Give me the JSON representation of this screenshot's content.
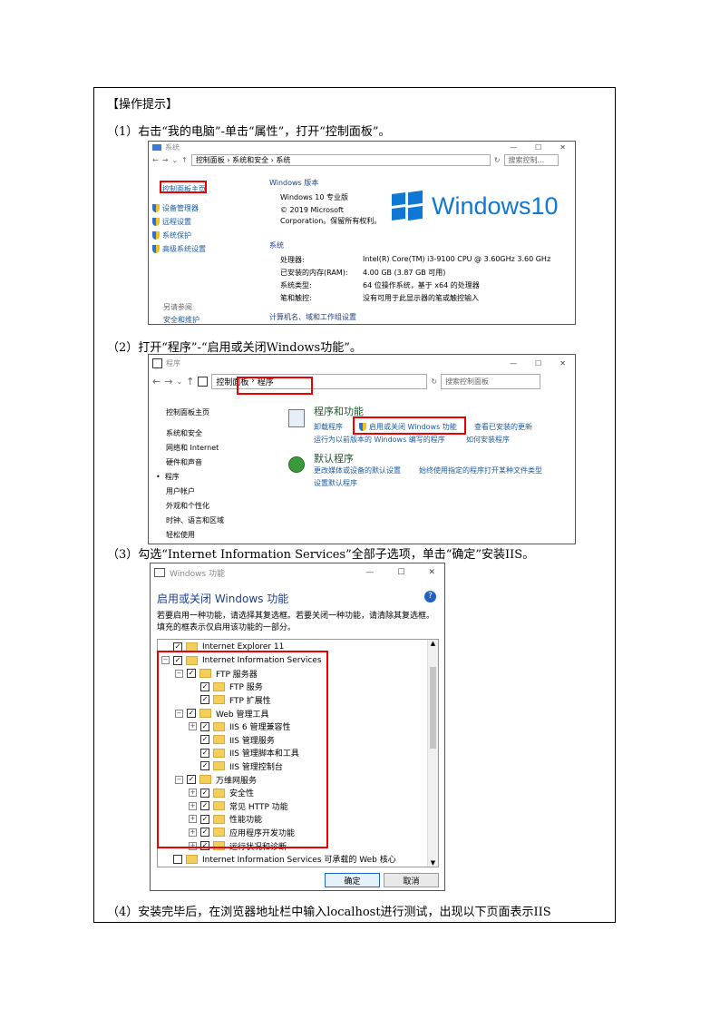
{
  "doc": {
    "heading": "【操作提示】",
    "step1": "（1）右击“我的电脑”-单击“属性”，打开“控制面板”。",
    "step2": "（2）打开“程序”-“启用或关闭Windows功能”。",
    "step3": "（3）勾选“Internet Information Services”全部子选项，单击“确定”安装IIS。",
    "step4": "（4）安装完毕后，在浏览器地址栏中输入localhost进行测试，出现以下页面表示IIS"
  },
  "shot1": {
    "title": "系统",
    "path": [
      "控制面板",
      "系统和安全",
      "系统"
    ],
    "search_placeholder": "搜索控制...",
    "home": "控制面板主页",
    "sidebar": [
      "设备管理器",
      "远程设置",
      "系统保护",
      "高级系统设置"
    ],
    "see_also": "另请参阅",
    "see_also_item": "安全和维护",
    "edition_header": "Windows 版本",
    "edition": "Windows 10 专业版",
    "copyright1": "© 2019 Microsoft",
    "copyright2": "Corporation。保留所有权利。",
    "logo_text": "Windows10",
    "system_header": "系统",
    "specs": [
      {
        "k": "处理器:",
        "v": "Intel(R) Core(TM) i3-9100 CPU @ 3.60GHz   3.60 GHz"
      },
      {
        "k": "已安装的内存(RAM):",
        "v": "4.00 GB (3.87 GB 可用)"
      },
      {
        "k": "系统类型:",
        "v": "64 位操作系统，基于 x64 的处理器"
      },
      {
        "k": "笔和触控:",
        "v": "没有可用于此显示器的笔或触控输入"
      }
    ],
    "footer": "计算机名、域和工作组设置"
  },
  "shot2": {
    "title": "程序",
    "path": [
      "控制面板",
      "程序"
    ],
    "search_placeholder": "搜索控制面板",
    "nav": [
      "控制面板主页",
      "系统和安全",
      "网络和 Internet",
      "硬件和声音",
      "程序",
      "用户帐户",
      "外观和个性化",
      "时钟、语言和区域",
      "轻松使用"
    ],
    "section1_title": "程序和功能",
    "section1_links": [
      "卸载程序",
      "启用或关闭 Windows 功能",
      "查看已安装的更新",
      "运行为以前版本的 Windows 编写的程序",
      "如何安装程序"
    ],
    "section2_title": "默认程序",
    "section2_links": [
      "更改媒体或设备的默认设置",
      "始终使用指定的程序打开某种文件类型",
      "设置默认程序"
    ]
  },
  "shot3": {
    "title": "Windows 功能",
    "heading": "启用或关闭 Windows 功能",
    "desc": "若要启用一种功能，请选择其复选框。若要关闭一种功能，请清除其复选框。填充的框表示仅启用该功能的一部分。",
    "tree": [
      {
        "label": "Internet Explorer 11",
        "level": 0,
        "expander": "",
        "checked": true
      },
      {
        "label": "Internet Information Services",
        "level": 0,
        "expander": "−",
        "checked": true
      },
      {
        "label": "FTP 服务器",
        "level": 1,
        "expander": "−",
        "checked": true
      },
      {
        "label": "FTP 服务",
        "level": 2,
        "expander": "",
        "checked": true
      },
      {
        "label": "FTP 扩展性",
        "level": 2,
        "expander": "",
        "checked": true
      },
      {
        "label": "Web 管理工具",
        "level": 1,
        "expander": "−",
        "checked": true
      },
      {
        "label": "IIS 6 管理兼容性",
        "level": 2,
        "expander": "+",
        "checked": true
      },
      {
        "label": "IIS 管理服务",
        "level": 2,
        "expander": "",
        "checked": true
      },
      {
        "label": "IIS 管理脚本和工具",
        "level": 2,
        "expander": "",
        "checked": true
      },
      {
        "label": "IIS 管理控制台",
        "level": 2,
        "expander": "",
        "checked": true
      },
      {
        "label": "万维网服务",
        "level": 1,
        "expander": "−",
        "checked": true
      },
      {
        "label": "安全性",
        "level": 2,
        "expander": "+",
        "checked": true
      },
      {
        "label": "常见 HTTP 功能",
        "level": 2,
        "expander": "+",
        "checked": true
      },
      {
        "label": "性能功能",
        "level": 2,
        "expander": "+",
        "checked": true
      },
      {
        "label": "应用程序开发功能",
        "level": 2,
        "expander": "+",
        "checked": true
      },
      {
        "label": "运行状况和诊断",
        "level": 2,
        "expander": "+",
        "checked": true
      },
      {
        "label": "Internet Information Services 可承载的 Web 核心",
        "level": 0,
        "expander": "",
        "checked": false
      }
    ],
    "ok": "确定",
    "cancel": "取消"
  }
}
